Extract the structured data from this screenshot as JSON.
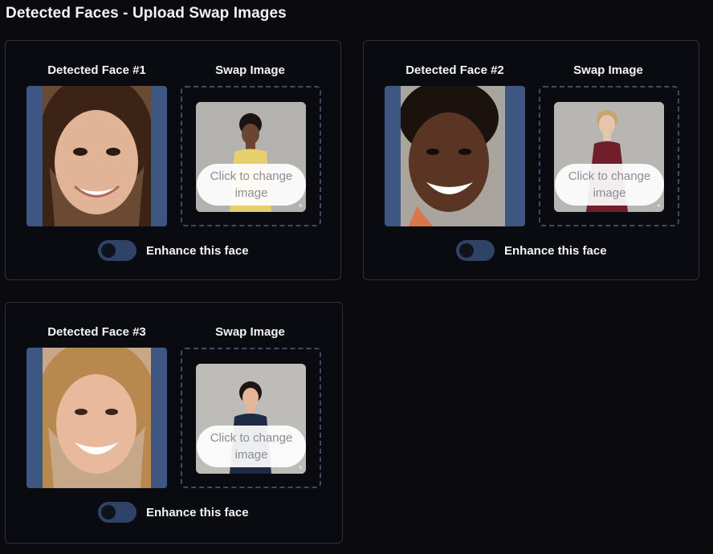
{
  "page": {
    "title": "Detected Faces - Upload Swap Images"
  },
  "faces": [
    {
      "detected_label": "Detected Face #1",
      "swap_label": "Swap Image",
      "change_text_line1": "Click to change",
      "change_text_line2": "image",
      "enhance_label": "Enhance this face",
      "enhance_on": false
    },
    {
      "detected_label": "Detected Face #2",
      "swap_label": "Swap Image",
      "change_text_line1": "Click to change",
      "change_text_line2": "image",
      "enhance_label": "Enhance this face",
      "enhance_on": false
    },
    {
      "detected_label": "Detected Face #3",
      "swap_label": "Swap Image",
      "change_text_line1": "Click to change",
      "change_text_line2": "image",
      "enhance_label": "Enhance this face",
      "enhance_on": false
    }
  ],
  "colors": {
    "background": "#0b0b0f",
    "card_border": "#2c3140",
    "face_backdrop": "#3d5782",
    "toggle_track": "#2e4365"
  }
}
